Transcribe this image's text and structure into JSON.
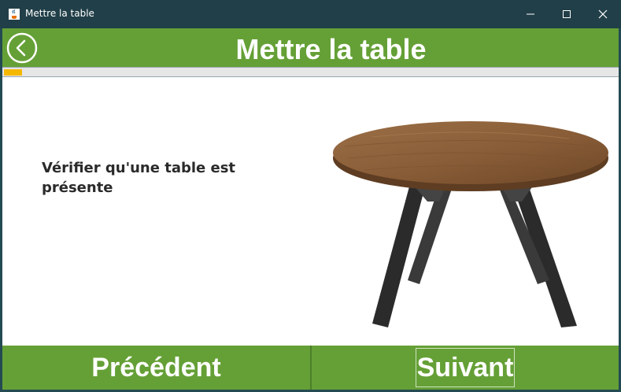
{
  "window": {
    "title": "Mettre la table",
    "app_icon": "java-cup-icon",
    "controls": [
      "minimize-icon",
      "maximize-icon",
      "close-icon"
    ]
  },
  "header": {
    "title": "Mettre la table",
    "back_icon": "chevron-left-icon",
    "background": "#65a036"
  },
  "progress": {
    "value": 0.03,
    "fill_color": "#f5b800"
  },
  "step": {
    "instruction": "Vérifier qu'une table est présente",
    "image": "round-wooden-table"
  },
  "footer": {
    "previous_label": "Précédent",
    "next_label": "Suivant"
  }
}
